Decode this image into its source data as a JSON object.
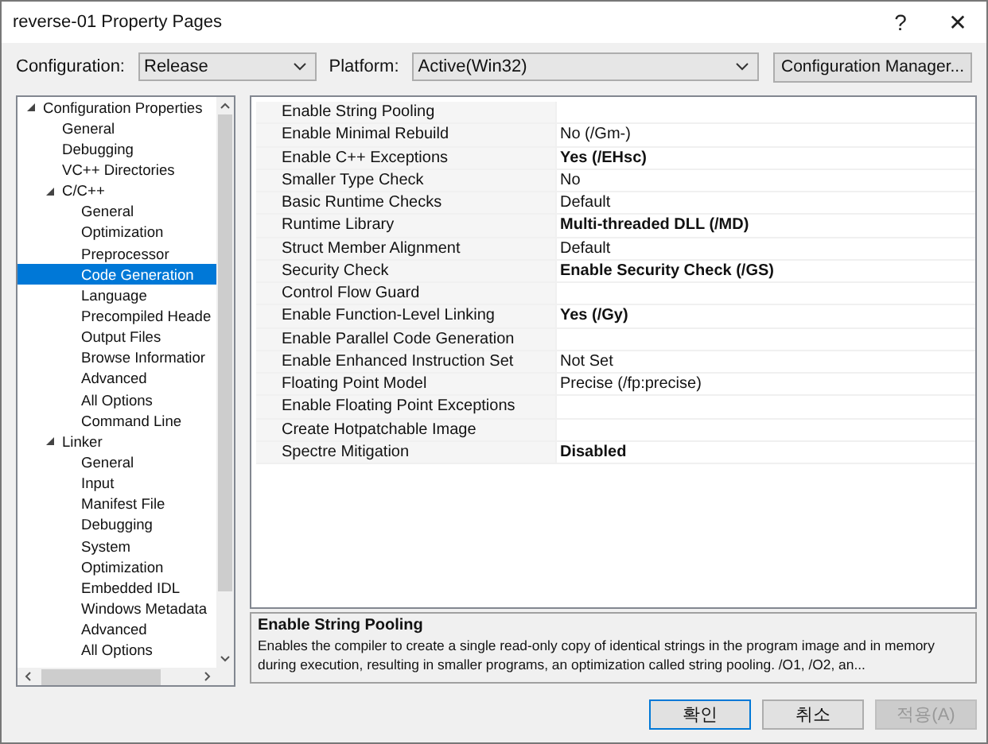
{
  "window": {
    "title": "reverse-01 Property Pages",
    "help": "?",
    "close": "✕"
  },
  "toolbar": {
    "configuration_label": "Configuration:",
    "configuration": "Release",
    "platform_label": "Platform:",
    "platform": "Active(Win32)",
    "manager_button": "Configuration Manager..."
  },
  "tree": [
    {
      "label": "Configuration Properties",
      "expanded": true,
      "selected": false,
      "children": [
        {
          "label": "General",
          "selected": false
        },
        {
          "label": "Debugging",
          "selected": false
        },
        {
          "label": "VC++ Directories",
          "selected": false
        },
        {
          "label": "C/C++",
          "expanded": true,
          "selected": false,
          "children": [
            {
              "label": "General",
              "selected": false
            },
            {
              "label": "Optimization",
              "selected": false
            },
            {
              "label": "Preprocessor",
              "selected": false
            },
            {
              "label": "Code Generation",
              "selected": true
            },
            {
              "label": "Language",
              "selected": false
            },
            {
              "label": "Precompiled Heade",
              "selected": false
            },
            {
              "label": "Output Files",
              "selected": false
            },
            {
              "label": "Browse Informatior",
              "selected": false
            },
            {
              "label": "Advanced",
              "selected": false
            },
            {
              "label": "All Options",
              "selected": false
            },
            {
              "label": "Command Line",
              "selected": false
            }
          ]
        },
        {
          "label": "Linker",
          "expanded": true,
          "selected": false,
          "children": [
            {
              "label": "General",
              "selected": false
            },
            {
              "label": "Input",
              "selected": false
            },
            {
              "label": "Manifest File",
              "selected": false
            },
            {
              "label": "Debugging",
              "selected": false
            },
            {
              "label": "System",
              "selected": false
            },
            {
              "label": "Optimization",
              "selected": false
            },
            {
              "label": "Embedded IDL",
              "selected": false
            },
            {
              "label": "Windows Metadata",
              "selected": false
            },
            {
              "label": "Advanced",
              "selected": false
            },
            {
              "label": "All Options",
              "selected": false
            }
          ]
        }
      ]
    }
  ],
  "properties": [
    {
      "name": "Enable String Pooling"
    },
    {
      "name": "Enable Minimal Rebuild",
      "value": "No (/Gm-)",
      "modified": false
    },
    {
      "name": "Enable C++ Exceptions",
      "value": "Yes (/EHsc)",
      "modified": true
    },
    {
      "name": "Smaller Type Check",
      "value": "No",
      "modified": false
    },
    {
      "name": "Basic Runtime Checks",
      "value": "Default",
      "modified": false
    },
    {
      "name": "Runtime Library",
      "value": "Multi-threaded DLL (/MD)",
      "modified": true
    },
    {
      "name": "Struct Member Alignment",
      "value": "Default",
      "modified": false
    },
    {
      "name": "Security Check",
      "value": "Enable Security Check (/GS)",
      "modified": true
    },
    {
      "name": "Control Flow Guard"
    },
    {
      "name": "Enable Function-Level Linking",
      "value": "Yes (/Gy)",
      "modified": true
    },
    {
      "name": "Enable Parallel Code Generation"
    },
    {
      "name": "Enable Enhanced Instruction Set",
      "value": "Not Set",
      "modified": false
    },
    {
      "name": "Floating Point Model",
      "value": "Precise (/fp:precise)",
      "modified": false
    },
    {
      "name": "Enable Floating Point Exceptions"
    },
    {
      "name": "Create Hotpatchable Image"
    },
    {
      "name": "Spectre Mitigation",
      "value": "Disabled",
      "modified": true
    }
  ],
  "description": {
    "title": "Enable String Pooling",
    "text": "Enables the compiler to create a single read-only copy of identical strings in the program image and in memory during execution, resulting in smaller programs, an optimization called string pooling. /O1, /O2, an..."
  },
  "buttons": [
    {
      "label": "확인",
      "kind": "default",
      "disabled": false
    },
    {
      "label": "취소",
      "kind": "normal",
      "disabled": false
    },
    {
      "label": "적용(A)",
      "kind": "normal",
      "disabled": true
    }
  ]
}
